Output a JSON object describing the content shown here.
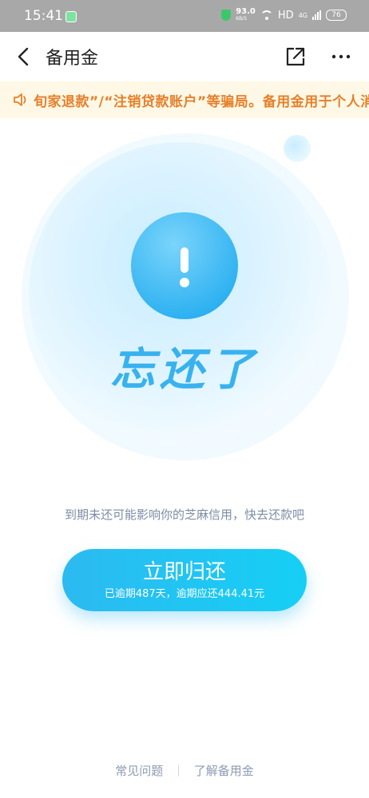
{
  "status": {
    "time": "15:41",
    "speed_value": "93.0",
    "speed_unit": "KB/S",
    "network": "HD",
    "network_gen": "4G",
    "battery": "76"
  },
  "nav": {
    "title": "备用金"
  },
  "notice": {
    "text": "旬家退款”/“注销贷款账户”等骗局。备用金用于个人消"
  },
  "hero": {
    "headline": "忘还了"
  },
  "hint": "到期未还可能影响你的芝麻信用，快去还款吧",
  "repay": {
    "label": "立即归还",
    "subtitle": "已逾期487天，逾期应还444.41元"
  },
  "footer": {
    "faq": "常见问题",
    "about": "了解备用金"
  },
  "colors": {
    "accent": "#1ec6f3",
    "notice_text": "#e5802b",
    "notice_bg": "#fff8e6"
  }
}
